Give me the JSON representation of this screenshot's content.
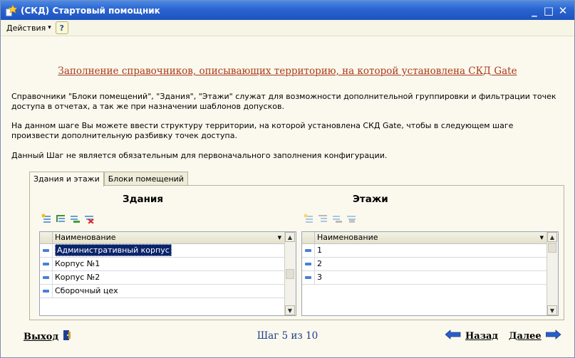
{
  "window": {
    "title": "(СКД) Стартовый помощник",
    "controls": [
      "_",
      "□",
      "✕"
    ]
  },
  "menu": {
    "actions_label": "Действия",
    "actions_arrow": "▾",
    "help_label": "?"
  },
  "heading": "Заполнение справочников, описывающих территорию, на которой установлена СКД Gate",
  "paragraphs": [
    "Справочники \"Блоки помещений\", \"Здания\", \"Этажи\" служат для возможности дополнительной группировки и фильтрации точек доступа в отчетах, а так же при назначении шаблонов допусков.",
    "На данном шаге Вы можете ввести структуру территории, на которой установлена СКД Gate, чтобы в следующем шаге произвести дополнительную разбивку точек доступа.",
    "Данный Шаг не является обязательным для первоначального заполнения конфигурации."
  ],
  "tabs": [
    "Здания и этажи",
    "Блоки помещений"
  ],
  "buildings": {
    "title": "Здания",
    "column": "Наименование",
    "rows": [
      "Административный корпус",
      "Корпус №1",
      "Корпус №2",
      "Сборочный цех"
    ],
    "selected_index": 0
  },
  "floors": {
    "title": "Этажи",
    "column": "Наименование",
    "rows": [
      "1",
      "2",
      "3"
    ]
  },
  "footer": {
    "exit_label": "Выход",
    "step_label": "Шаг 5 из 10",
    "back_label": "Назад",
    "next_label": "Далее"
  },
  "colors": {
    "titlebar": "#2a64cf",
    "heading": "#a9391a",
    "step": "#1f3d8a",
    "selection": "#0a246a"
  }
}
